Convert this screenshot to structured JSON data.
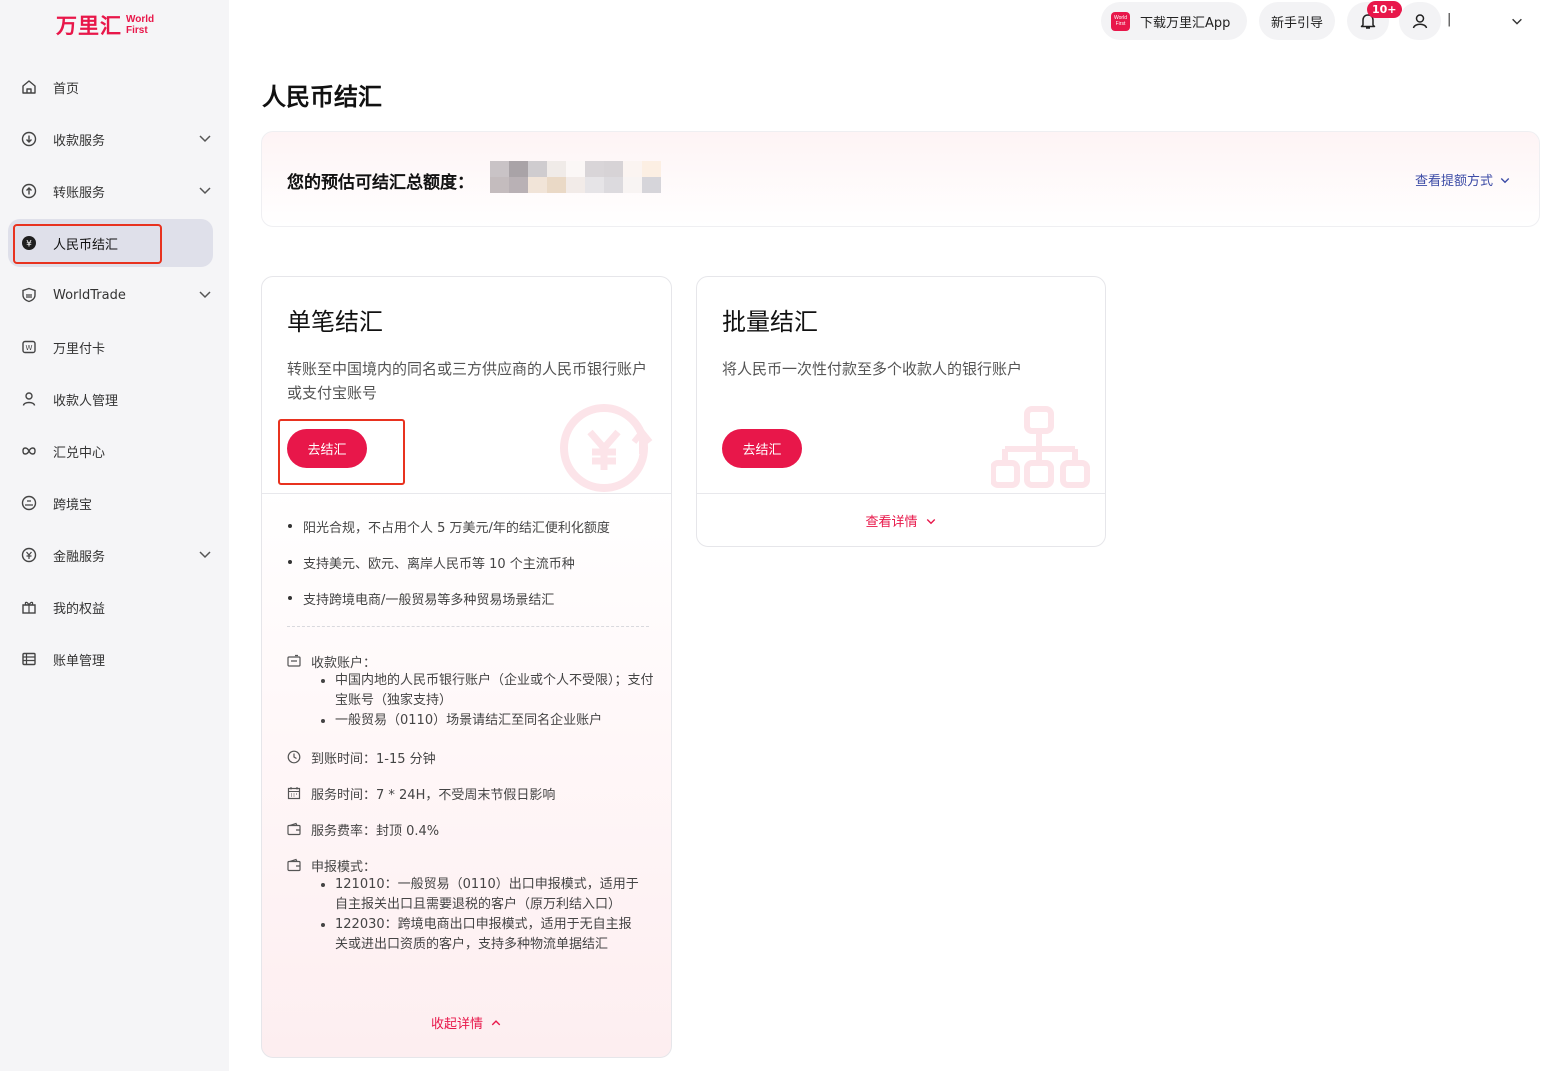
{
  "brand": {
    "name_cn": "万里汇",
    "name_en_line1": "World",
    "name_en_line2": "First",
    "accent": "#e8174a"
  },
  "sidebar": {
    "items": [
      {
        "label": "首页",
        "icon": "home-icon",
        "expandable": false
      },
      {
        "label": "收款服务",
        "icon": "receive-icon",
        "expandable": true
      },
      {
        "label": "转账服务",
        "icon": "transfer-icon",
        "expandable": true
      },
      {
        "label": "人民币结汇",
        "icon": "rmb-exchange-icon",
        "expandable": false,
        "active": true
      },
      {
        "label": "WorldTrade",
        "icon": "shield-icon",
        "expandable": true
      },
      {
        "label": "万里付卡",
        "icon": "card-icon",
        "expandable": false
      },
      {
        "label": "收款人管理",
        "icon": "payee-icon",
        "expandable": false
      },
      {
        "label": "汇兑中心",
        "icon": "exchange-icon",
        "expandable": false
      },
      {
        "label": "跨境宝",
        "icon": "crossborder-icon",
        "expandable": false
      },
      {
        "label": "金融服务",
        "icon": "finance-icon",
        "expandable": true
      },
      {
        "label": "我的权益",
        "icon": "gift-icon",
        "expandable": false
      },
      {
        "label": "账单管理",
        "icon": "bill-icon",
        "expandable": false
      }
    ]
  },
  "header": {
    "app_mini_logo_line1": "World",
    "app_mini_logo_line2": "First",
    "download_app": "下载万里汇App",
    "guide": "新手引导",
    "notification_badge": "10+",
    "user_name": "|"
  },
  "main": {
    "title": "人民币结汇",
    "quota": {
      "label": "您的预估可结汇总额度：",
      "link": "查看提额方式"
    },
    "single": {
      "title": "单笔结汇",
      "desc": "转账至中国境内的同名或三方供应商的人民币银行账户或支付宝账号",
      "button": "去结汇",
      "features": [
        "阳光合规，不占用个人 5 万美元/年的结汇便利化额度",
        "支持美元、欧元、离岸人民币等 10 个主流币种",
        "支持跨境电商/一般贸易等多种贸易场景结汇"
      ],
      "account_label": "收款账户：",
      "account_items": [
        "中国内地的人民币银行账户（企业或个人不受限）；支付宝账号（独家支持）",
        "一般贸易（0110）场景请结汇至同名企业账户"
      ],
      "arrival": "到账时间：1-15 分钟",
      "service_time": "服务时间：7 * 24H，不受周末节假日影响",
      "fee": "服务费率：封顶 0.4%",
      "declare_label": "申报模式：",
      "declare_items": [
        "121010：一般贸易（0110）出口申报模式，适用于自主报关出口且需要退税的客户（原万利结入口）",
        "122030：跨境电商出口申报模式，适用于无自主报关或进出口资质的客户，支持多种物流单据结汇"
      ],
      "collapse": "收起详情"
    },
    "batch": {
      "title": "批量结汇",
      "desc": "将人民币一次性付款至多个收款人的银行账户",
      "button": "去结汇",
      "details": "查看详情"
    }
  }
}
